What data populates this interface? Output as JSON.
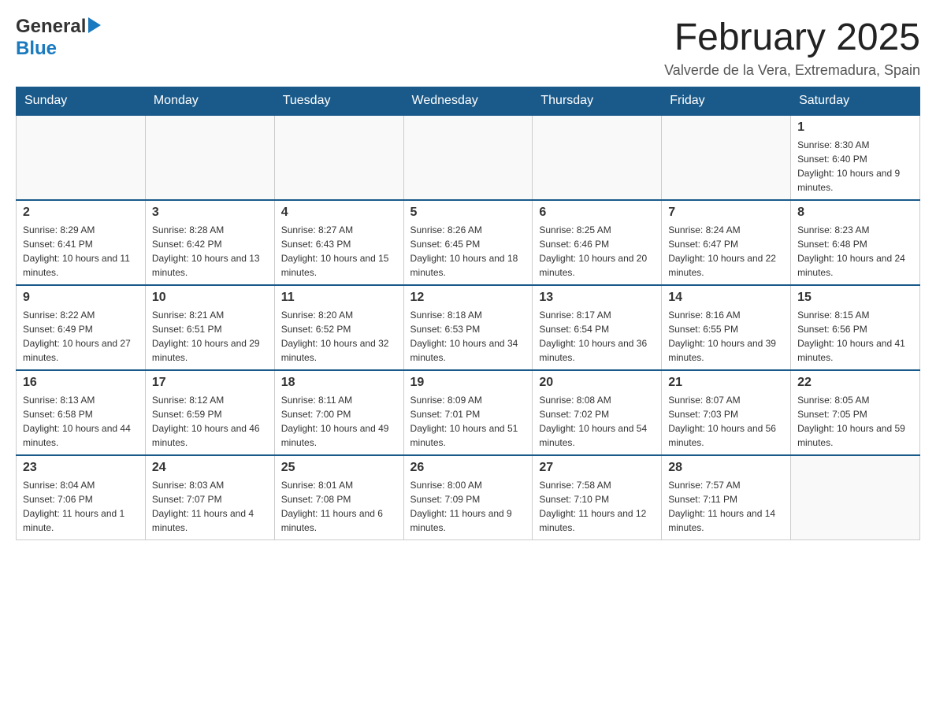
{
  "logo": {
    "general": "General",
    "blue": "Blue"
  },
  "header": {
    "title": "February 2025",
    "location": "Valverde de la Vera, Extremadura, Spain"
  },
  "weekdays": [
    "Sunday",
    "Monday",
    "Tuesday",
    "Wednesday",
    "Thursday",
    "Friday",
    "Saturday"
  ],
  "weeks": [
    [
      {
        "day": "",
        "info": ""
      },
      {
        "day": "",
        "info": ""
      },
      {
        "day": "",
        "info": ""
      },
      {
        "day": "",
        "info": ""
      },
      {
        "day": "",
        "info": ""
      },
      {
        "day": "",
        "info": ""
      },
      {
        "day": "1",
        "info": "Sunrise: 8:30 AM\nSunset: 6:40 PM\nDaylight: 10 hours and 9 minutes."
      }
    ],
    [
      {
        "day": "2",
        "info": "Sunrise: 8:29 AM\nSunset: 6:41 PM\nDaylight: 10 hours and 11 minutes."
      },
      {
        "day": "3",
        "info": "Sunrise: 8:28 AM\nSunset: 6:42 PM\nDaylight: 10 hours and 13 minutes."
      },
      {
        "day": "4",
        "info": "Sunrise: 8:27 AM\nSunset: 6:43 PM\nDaylight: 10 hours and 15 minutes."
      },
      {
        "day": "5",
        "info": "Sunrise: 8:26 AM\nSunset: 6:45 PM\nDaylight: 10 hours and 18 minutes."
      },
      {
        "day": "6",
        "info": "Sunrise: 8:25 AM\nSunset: 6:46 PM\nDaylight: 10 hours and 20 minutes."
      },
      {
        "day": "7",
        "info": "Sunrise: 8:24 AM\nSunset: 6:47 PM\nDaylight: 10 hours and 22 minutes."
      },
      {
        "day": "8",
        "info": "Sunrise: 8:23 AM\nSunset: 6:48 PM\nDaylight: 10 hours and 24 minutes."
      }
    ],
    [
      {
        "day": "9",
        "info": "Sunrise: 8:22 AM\nSunset: 6:49 PM\nDaylight: 10 hours and 27 minutes."
      },
      {
        "day": "10",
        "info": "Sunrise: 8:21 AM\nSunset: 6:51 PM\nDaylight: 10 hours and 29 minutes."
      },
      {
        "day": "11",
        "info": "Sunrise: 8:20 AM\nSunset: 6:52 PM\nDaylight: 10 hours and 32 minutes."
      },
      {
        "day": "12",
        "info": "Sunrise: 8:18 AM\nSunset: 6:53 PM\nDaylight: 10 hours and 34 minutes."
      },
      {
        "day": "13",
        "info": "Sunrise: 8:17 AM\nSunset: 6:54 PM\nDaylight: 10 hours and 36 minutes."
      },
      {
        "day": "14",
        "info": "Sunrise: 8:16 AM\nSunset: 6:55 PM\nDaylight: 10 hours and 39 minutes."
      },
      {
        "day": "15",
        "info": "Sunrise: 8:15 AM\nSunset: 6:56 PM\nDaylight: 10 hours and 41 minutes."
      }
    ],
    [
      {
        "day": "16",
        "info": "Sunrise: 8:13 AM\nSunset: 6:58 PM\nDaylight: 10 hours and 44 minutes."
      },
      {
        "day": "17",
        "info": "Sunrise: 8:12 AM\nSunset: 6:59 PM\nDaylight: 10 hours and 46 minutes."
      },
      {
        "day": "18",
        "info": "Sunrise: 8:11 AM\nSunset: 7:00 PM\nDaylight: 10 hours and 49 minutes."
      },
      {
        "day": "19",
        "info": "Sunrise: 8:09 AM\nSunset: 7:01 PM\nDaylight: 10 hours and 51 minutes."
      },
      {
        "day": "20",
        "info": "Sunrise: 8:08 AM\nSunset: 7:02 PM\nDaylight: 10 hours and 54 minutes."
      },
      {
        "day": "21",
        "info": "Sunrise: 8:07 AM\nSunset: 7:03 PM\nDaylight: 10 hours and 56 minutes."
      },
      {
        "day": "22",
        "info": "Sunrise: 8:05 AM\nSunset: 7:05 PM\nDaylight: 10 hours and 59 minutes."
      }
    ],
    [
      {
        "day": "23",
        "info": "Sunrise: 8:04 AM\nSunset: 7:06 PM\nDaylight: 11 hours and 1 minute."
      },
      {
        "day": "24",
        "info": "Sunrise: 8:03 AM\nSunset: 7:07 PM\nDaylight: 11 hours and 4 minutes."
      },
      {
        "day": "25",
        "info": "Sunrise: 8:01 AM\nSunset: 7:08 PM\nDaylight: 11 hours and 6 minutes."
      },
      {
        "day": "26",
        "info": "Sunrise: 8:00 AM\nSunset: 7:09 PM\nDaylight: 11 hours and 9 minutes."
      },
      {
        "day": "27",
        "info": "Sunrise: 7:58 AM\nSunset: 7:10 PM\nDaylight: 11 hours and 12 minutes."
      },
      {
        "day": "28",
        "info": "Sunrise: 7:57 AM\nSunset: 7:11 PM\nDaylight: 11 hours and 14 minutes."
      },
      {
        "day": "",
        "info": ""
      }
    ]
  ]
}
